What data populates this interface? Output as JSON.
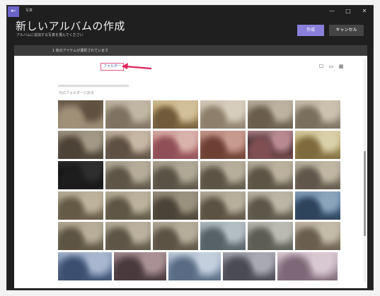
{
  "window": {
    "app_name": "写真",
    "back_icon": "back-arrow-icon",
    "controls": [
      "—",
      "□",
      "✕"
    ]
  },
  "header": {
    "title": "新しいアルバムの作成",
    "subtitle": "アルバムに追加する写真を選んでください",
    "create_label": "作成",
    "cancel_label": "キャンセル"
  },
  "selection": {
    "text": "1 枚のアイテムが選択されています"
  },
  "toolbar": {
    "folder_label": "フォルダー",
    "arrow_color": "#e0245e"
  },
  "browser": {
    "back_to_folder": "元のフォルダーに戻る"
  },
  "thumbnail_rows": [
    [
      {
        "w": 64,
        "c": [
          "#8a7a66",
          "#a09078",
          "#605040"
        ]
      },
      {
        "w": 64,
        "c": [
          "#a69a86",
          "#7f7261",
          "#c1b6a3"
        ]
      },
      {
        "w": 64,
        "c": [
          "#b39a68",
          "#6f5b3b",
          "#d2c09a"
        ]
      },
      {
        "w": 64,
        "c": [
          "#b9ad9a",
          "#8d7f6b",
          "#d7cdbd"
        ]
      },
      {
        "w": 64,
        "c": [
          "#908573",
          "#6a5d4b",
          "#bdb2a0"
        ]
      },
      {
        "w": 64,
        "c": [
          "#a79c8a",
          "#7a6e5c",
          "#cbc1ae"
        ]
      }
    ],
    [
      {
        "w": 64,
        "c": [
          "#6e6353",
          "#4d4236",
          "#a39885"
        ]
      },
      {
        "w": 64,
        "c": [
          "#8f7e6d",
          "#5e5043",
          "#c6b7a5"
        ]
      },
      {
        "w": 64,
        "c": [
          "#b87775",
          "#8f4f57",
          "#d9b2ab"
        ]
      },
      {
        "w": 64,
        "c": [
          "#9d6a5d",
          "#6e4034",
          "#c79a8f"
        ]
      },
      {
        "w": 64,
        "c": [
          "#3a2a2a",
          "#7f4f52",
          "#b88a90"
        ]
      },
      {
        "w": 64,
        "c": [
          "#b3a06a",
          "#7d6b3d",
          "#d9cfa8"
        ]
      }
    ],
    [
      {
        "w": 64,
        "c": [
          "#111111",
          "#1d1d1d",
          "#2e2e2e"
        ]
      },
      {
        "w": 64,
        "c": [
          "#8a8070",
          "#5f5546",
          "#b5ab98"
        ]
      },
      {
        "w": 64,
        "c": [
          "#87806f",
          "#5a5244",
          "#b0a795"
        ]
      },
      {
        "w": 64,
        "c": [
          "#8c8371",
          "#5c5345",
          "#b7ad9b"
        ]
      },
      {
        "w": 64,
        "c": [
          "#8e8574",
          "#5d5446",
          "#bab09d"
        ]
      },
      {
        "w": 64,
        "c": [
          "#938a79",
          "#60574a",
          "#c0b6a3"
        ]
      }
    ],
    [
      {
        "w": 64,
        "c": [
          "#91866f",
          "#655a46",
          "#bdb29c"
        ]
      },
      {
        "w": 64,
        "c": [
          "#8e8570",
          "#5f5645",
          "#bbb19c"
        ]
      },
      {
        "w": 64,
        "c": [
          "#6f6656",
          "#4b4337",
          "#9b917f"
        ]
      },
      {
        "w": 64,
        "c": [
          "#8c8371",
          "#5b5244",
          "#b7ad9b"
        ]
      },
      {
        "w": 64,
        "c": [
          "#908a7a",
          "#5d574a",
          "#bbb5a5"
        ]
      },
      {
        "w": 64,
        "c": [
          "#4b6a8a",
          "#2e435c",
          "#8aa4bc"
        ]
      }
    ],
    [
      {
        "w": 64,
        "c": [
          "#8a806c",
          "#5d5443",
          "#b8ad98"
        ]
      },
      {
        "w": 64,
        "c": [
          "#8d8371",
          "#5f5546",
          "#bab09d"
        ]
      },
      {
        "w": 64,
        "c": [
          "#8a816f",
          "#5c5345",
          "#b6ac9a"
        ]
      },
      {
        "w": 64,
        "c": [
          "#7f8b91",
          "#566268",
          "#b3bec3"
        ]
      },
      {
        "w": 64,
        "c": [
          "#8b8b82",
          "#5d5d56",
          "#bbbab1"
        ]
      },
      {
        "w": 64,
        "c": [
          "#9a8f7e",
          "#6a5f4f",
          "#c4baa8"
        ]
      }
    ],
    [
      {
        "w": 76,
        "c": [
          "#6b80a3",
          "#3c4f70",
          "#a8b7cf"
        ]
      },
      {
        "w": 74,
        "c": [
          "#6e5a5e",
          "#4a3a3e",
          "#a89094"
        ]
      },
      {
        "w": 74,
        "c": [
          "#8a9cb3",
          "#5a6c85",
          "#c3cfdd"
        ]
      },
      {
        "w": 74,
        "c": [
          "#6f6f7a",
          "#4b4b55",
          "#a9a9b3"
        ]
      },
      {
        "w": 85,
        "c": [
          "#b09aa8",
          "#7e6877",
          "#d8c8d2"
        ]
      }
    ]
  ]
}
